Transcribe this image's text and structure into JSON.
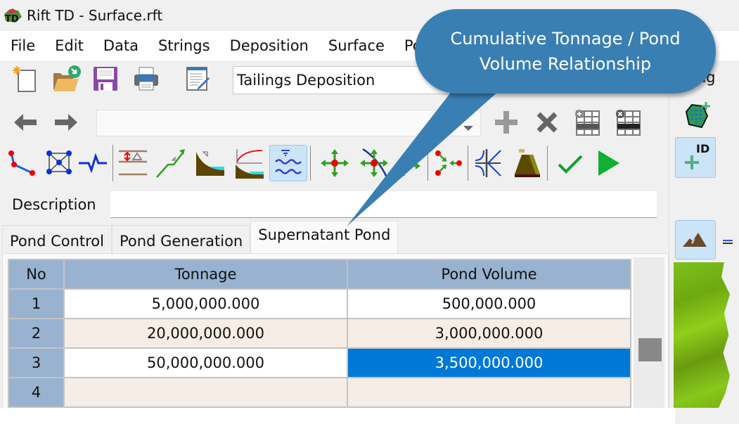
{
  "window": {
    "title": "Rift TD - Surface.rft",
    "app_icon": "rift-td-logo-icon"
  },
  "menubar": {
    "items": [
      "File",
      "Edit",
      "Data",
      "Strings",
      "Deposition",
      "Surface",
      "Po"
    ]
  },
  "toolbar": {
    "row1": {
      "icons": [
        "new-file-icon",
        "open-folder-icon",
        "save-icon",
        "print-icon",
        "edit-notes-icon"
      ],
      "combo_value": "Tailings Deposition",
      "right_partial_label": "ing"
    },
    "row2": {
      "icons": [
        "back-arrow-icon",
        "forward-arrow-icon",
        "add-icon",
        "delete-icon",
        "insert-row-icon",
        "delete-row-icon"
      ],
      "combo_value": ""
    },
    "row3": {
      "icons": [
        "polyline-icon",
        "mesh-nodes-icon",
        "profile-line-icon",
        "elevation-offset-icon",
        "slope-line-icon",
        "beach-slope-icon",
        "beach-curve-icon",
        "supernatant-pond-icon",
        "move-point-icon",
        "move-along-string-icon",
        "move-axis-icon",
        "converge-points-icon",
        "intersect-lines-icon",
        "embankment-icon",
        "validate-check-icon",
        "run-play-icon"
      ],
      "active_icon": "supernatant-pond-icon"
    }
  },
  "right_panel": {
    "icons": [
      "add-polygon-icon",
      "add-id-icon",
      "terrain-icon"
    ]
  },
  "description": {
    "label": "Description",
    "value": ""
  },
  "tabs": [
    {
      "label": "Pond Control",
      "active": false
    },
    {
      "label": "Pond Generation",
      "active": false
    },
    {
      "label": "Supernatant Pond",
      "active": true
    }
  ],
  "grid": {
    "headers": [
      "No",
      "Tonnage",
      "Pond Volume"
    ],
    "rows": [
      {
        "no": "1",
        "tonnage": "5,000,000.000",
        "volume": "500,000.000"
      },
      {
        "no": "2",
        "tonnage": "20,000,000.000",
        "volume": "3,000,000.000"
      },
      {
        "no": "3",
        "tonnage": "50,000,000.000",
        "volume": "3,500,000.000"
      },
      {
        "no": "4",
        "tonnage": "",
        "volume": ""
      }
    ],
    "selected_cell": {
      "row": 3,
      "column": "Pond Volume"
    }
  },
  "callout": {
    "text_line1": "Cumulative Tonnage / Pond",
    "text_line2": "Volume Relationship",
    "color": "#3a7fb3"
  },
  "colors": {
    "header_bg": "#98b2d0",
    "selection": "#0078d7",
    "alt_row": "#f5ede6"
  }
}
